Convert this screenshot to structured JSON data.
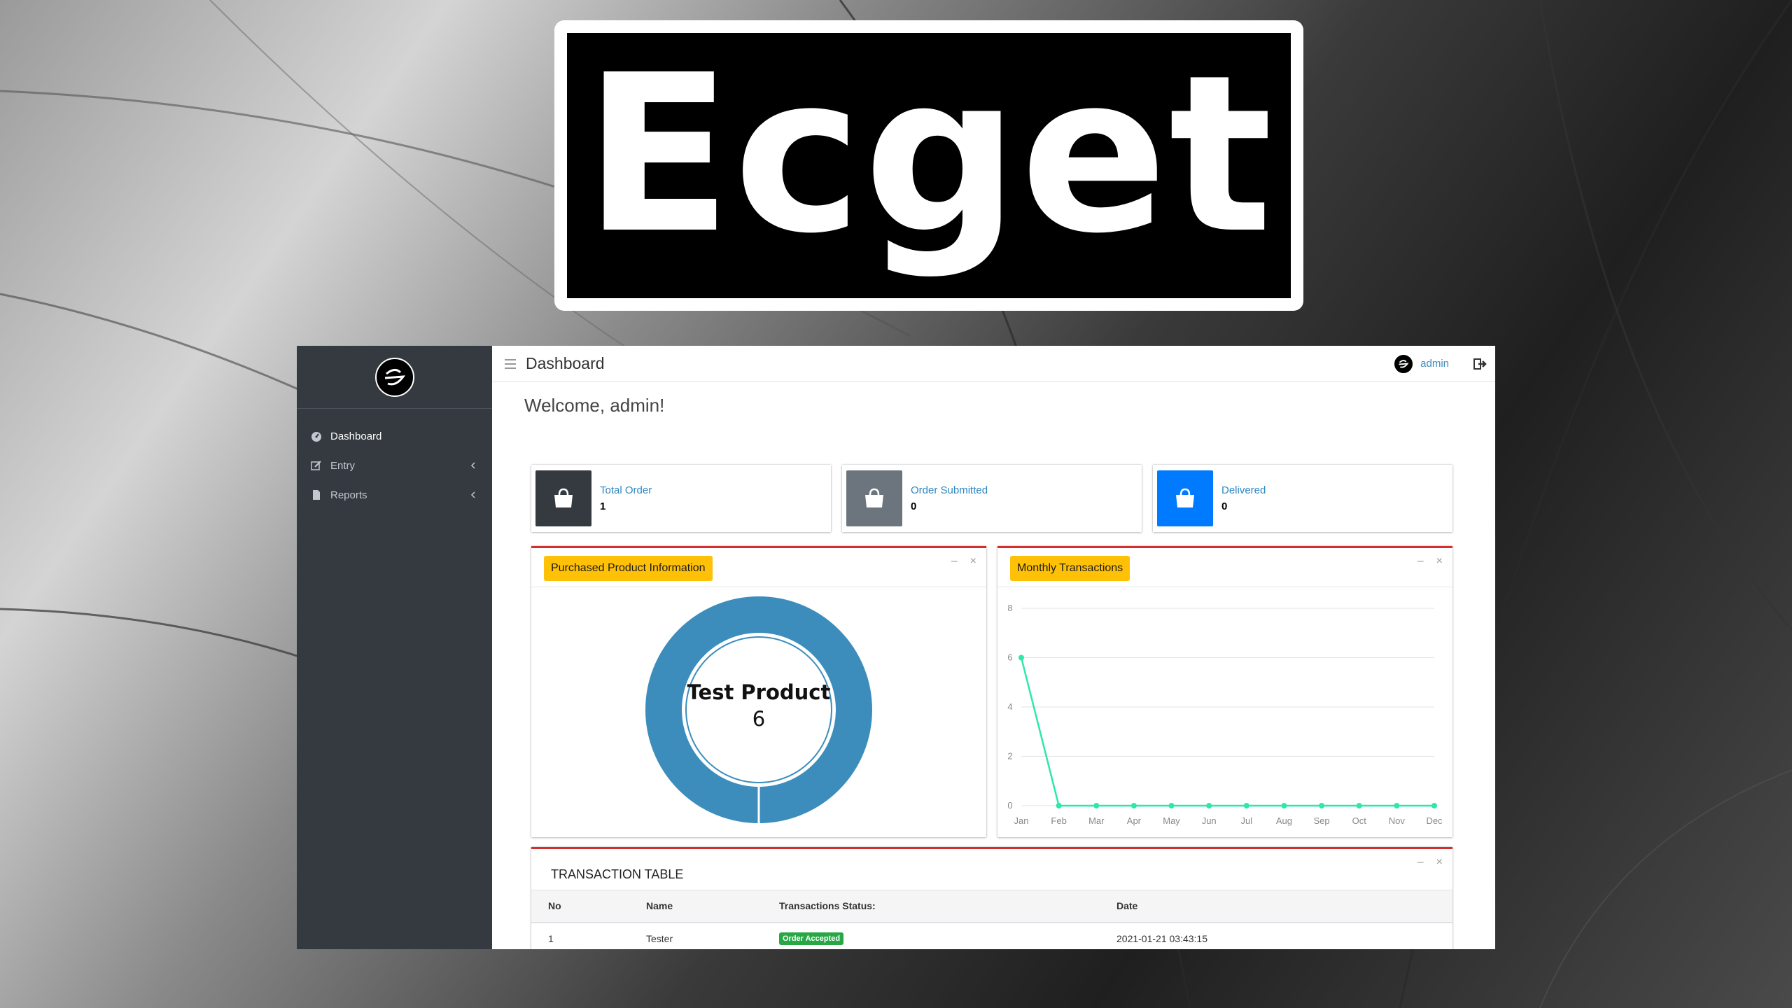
{
  "banner": {
    "title": "Ecget"
  },
  "app": {
    "sidebar": {
      "items": [
        {
          "label": "Dashboard",
          "icon": "dashboard-icon",
          "has_submenu": false
        },
        {
          "label": "Entry",
          "icon": "edit-icon",
          "has_submenu": true
        },
        {
          "label": "Reports",
          "icon": "file-icon",
          "has_submenu": true
        }
      ]
    },
    "topbar": {
      "title": "Dashboard",
      "user": "admin"
    },
    "welcome": "Welcome, admin!",
    "stats": [
      {
        "label": "Total Order",
        "value": "1",
        "color": "#343a40"
      },
      {
        "label": "Order Submitted",
        "value": "0",
        "color": "#6c757d"
      },
      {
        "label": "Delivered",
        "value": "0",
        "color": "#007bff"
      }
    ],
    "purchased_card": {
      "title": "Purchased Product Information",
      "center_label": "Test Product",
      "center_value": "6"
    },
    "monthly_card": {
      "title": "Monthly Transactions"
    },
    "transaction_table": {
      "title": "TRANSACTION TABLE",
      "columns": [
        "No",
        "Name",
        "Transactions Status:",
        "Date"
      ],
      "rows": [
        {
          "no": "1",
          "name": "Tester",
          "status": "Order Accepted",
          "date": "2021-01-21 03:43:15"
        }
      ]
    }
  },
  "chart_data": [
    {
      "type": "pie",
      "labels": [
        "Test Product"
      ],
      "values": [
        6
      ],
      "colors": [
        "#3c8dbc"
      ]
    },
    {
      "type": "line",
      "categories": [
        "Jan",
        "Feb",
        "Mar",
        "Apr",
        "May",
        "Jun",
        "Jul",
        "Aug",
        "Sep",
        "Oct",
        "Nov",
        "Dec"
      ],
      "series": [
        {
          "values": [
            6,
            0,
            0,
            0,
            0,
            0,
            0,
            0,
            0,
            0,
            0,
            0
          ],
          "color": "#2ee8a6"
        }
      ],
      "ylim": [
        0,
        8
      ],
      "yticks": [
        "0",
        "2",
        "4",
        "6",
        "8"
      ],
      "grid": true
    }
  ]
}
